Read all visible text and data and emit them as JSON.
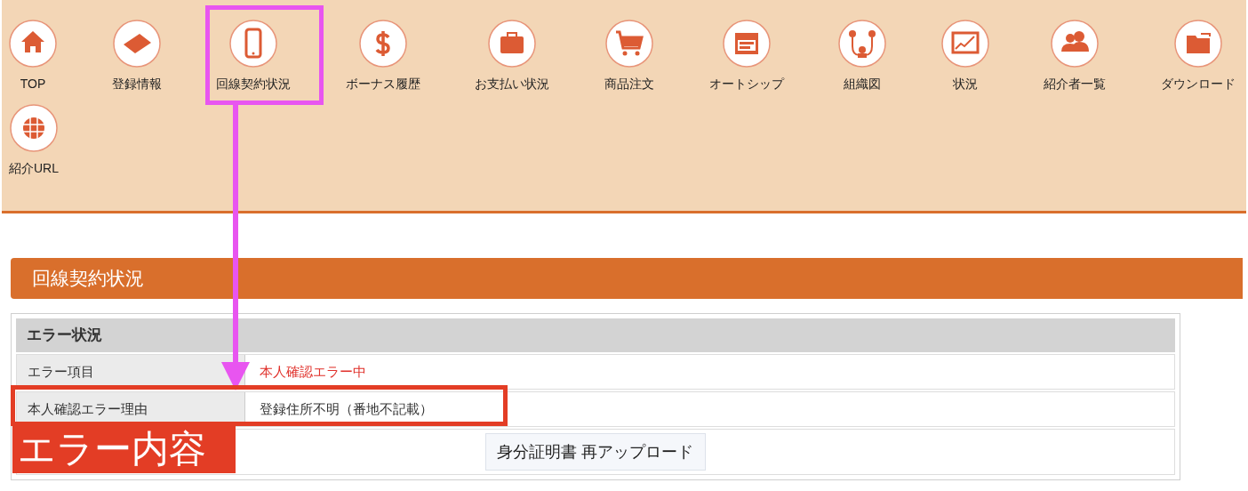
{
  "nav": {
    "rows": [
      [
        {
          "label": "TOP",
          "kind": "home"
        },
        {
          "label": "登録情報",
          "kind": "card"
        },
        {
          "label": "回線契約状況",
          "kind": "phone"
        },
        {
          "label": "ボーナス履歴",
          "kind": "dollar"
        },
        {
          "label": "お支払い状況",
          "kind": "briefcase"
        },
        {
          "label": "商品注文",
          "kind": "cart"
        },
        {
          "label": "オートシップ",
          "kind": "calendar"
        },
        {
          "label": "組織図",
          "kind": "org"
        },
        {
          "label": "状況",
          "kind": "chart"
        },
        {
          "label": "紹介者一覧",
          "kind": "users"
        },
        {
          "label": "ダウンロード",
          "kind": "folder"
        }
      ],
      [
        {
          "label": "紹介URL",
          "kind": "globe"
        }
      ]
    ]
  },
  "section_title": "回線契約状況",
  "error_table": {
    "heading": "エラー状況",
    "rows": [
      {
        "label": "エラー項目",
        "value": "本人確認エラー中",
        "alert": true
      },
      {
        "label": "本人確認エラー理由",
        "value": "登録住所不明（番地不記載）",
        "alert": false
      }
    ],
    "button": "身分証明書 再アップロード"
  },
  "annotations": {
    "callout_label": "エラー内容"
  }
}
